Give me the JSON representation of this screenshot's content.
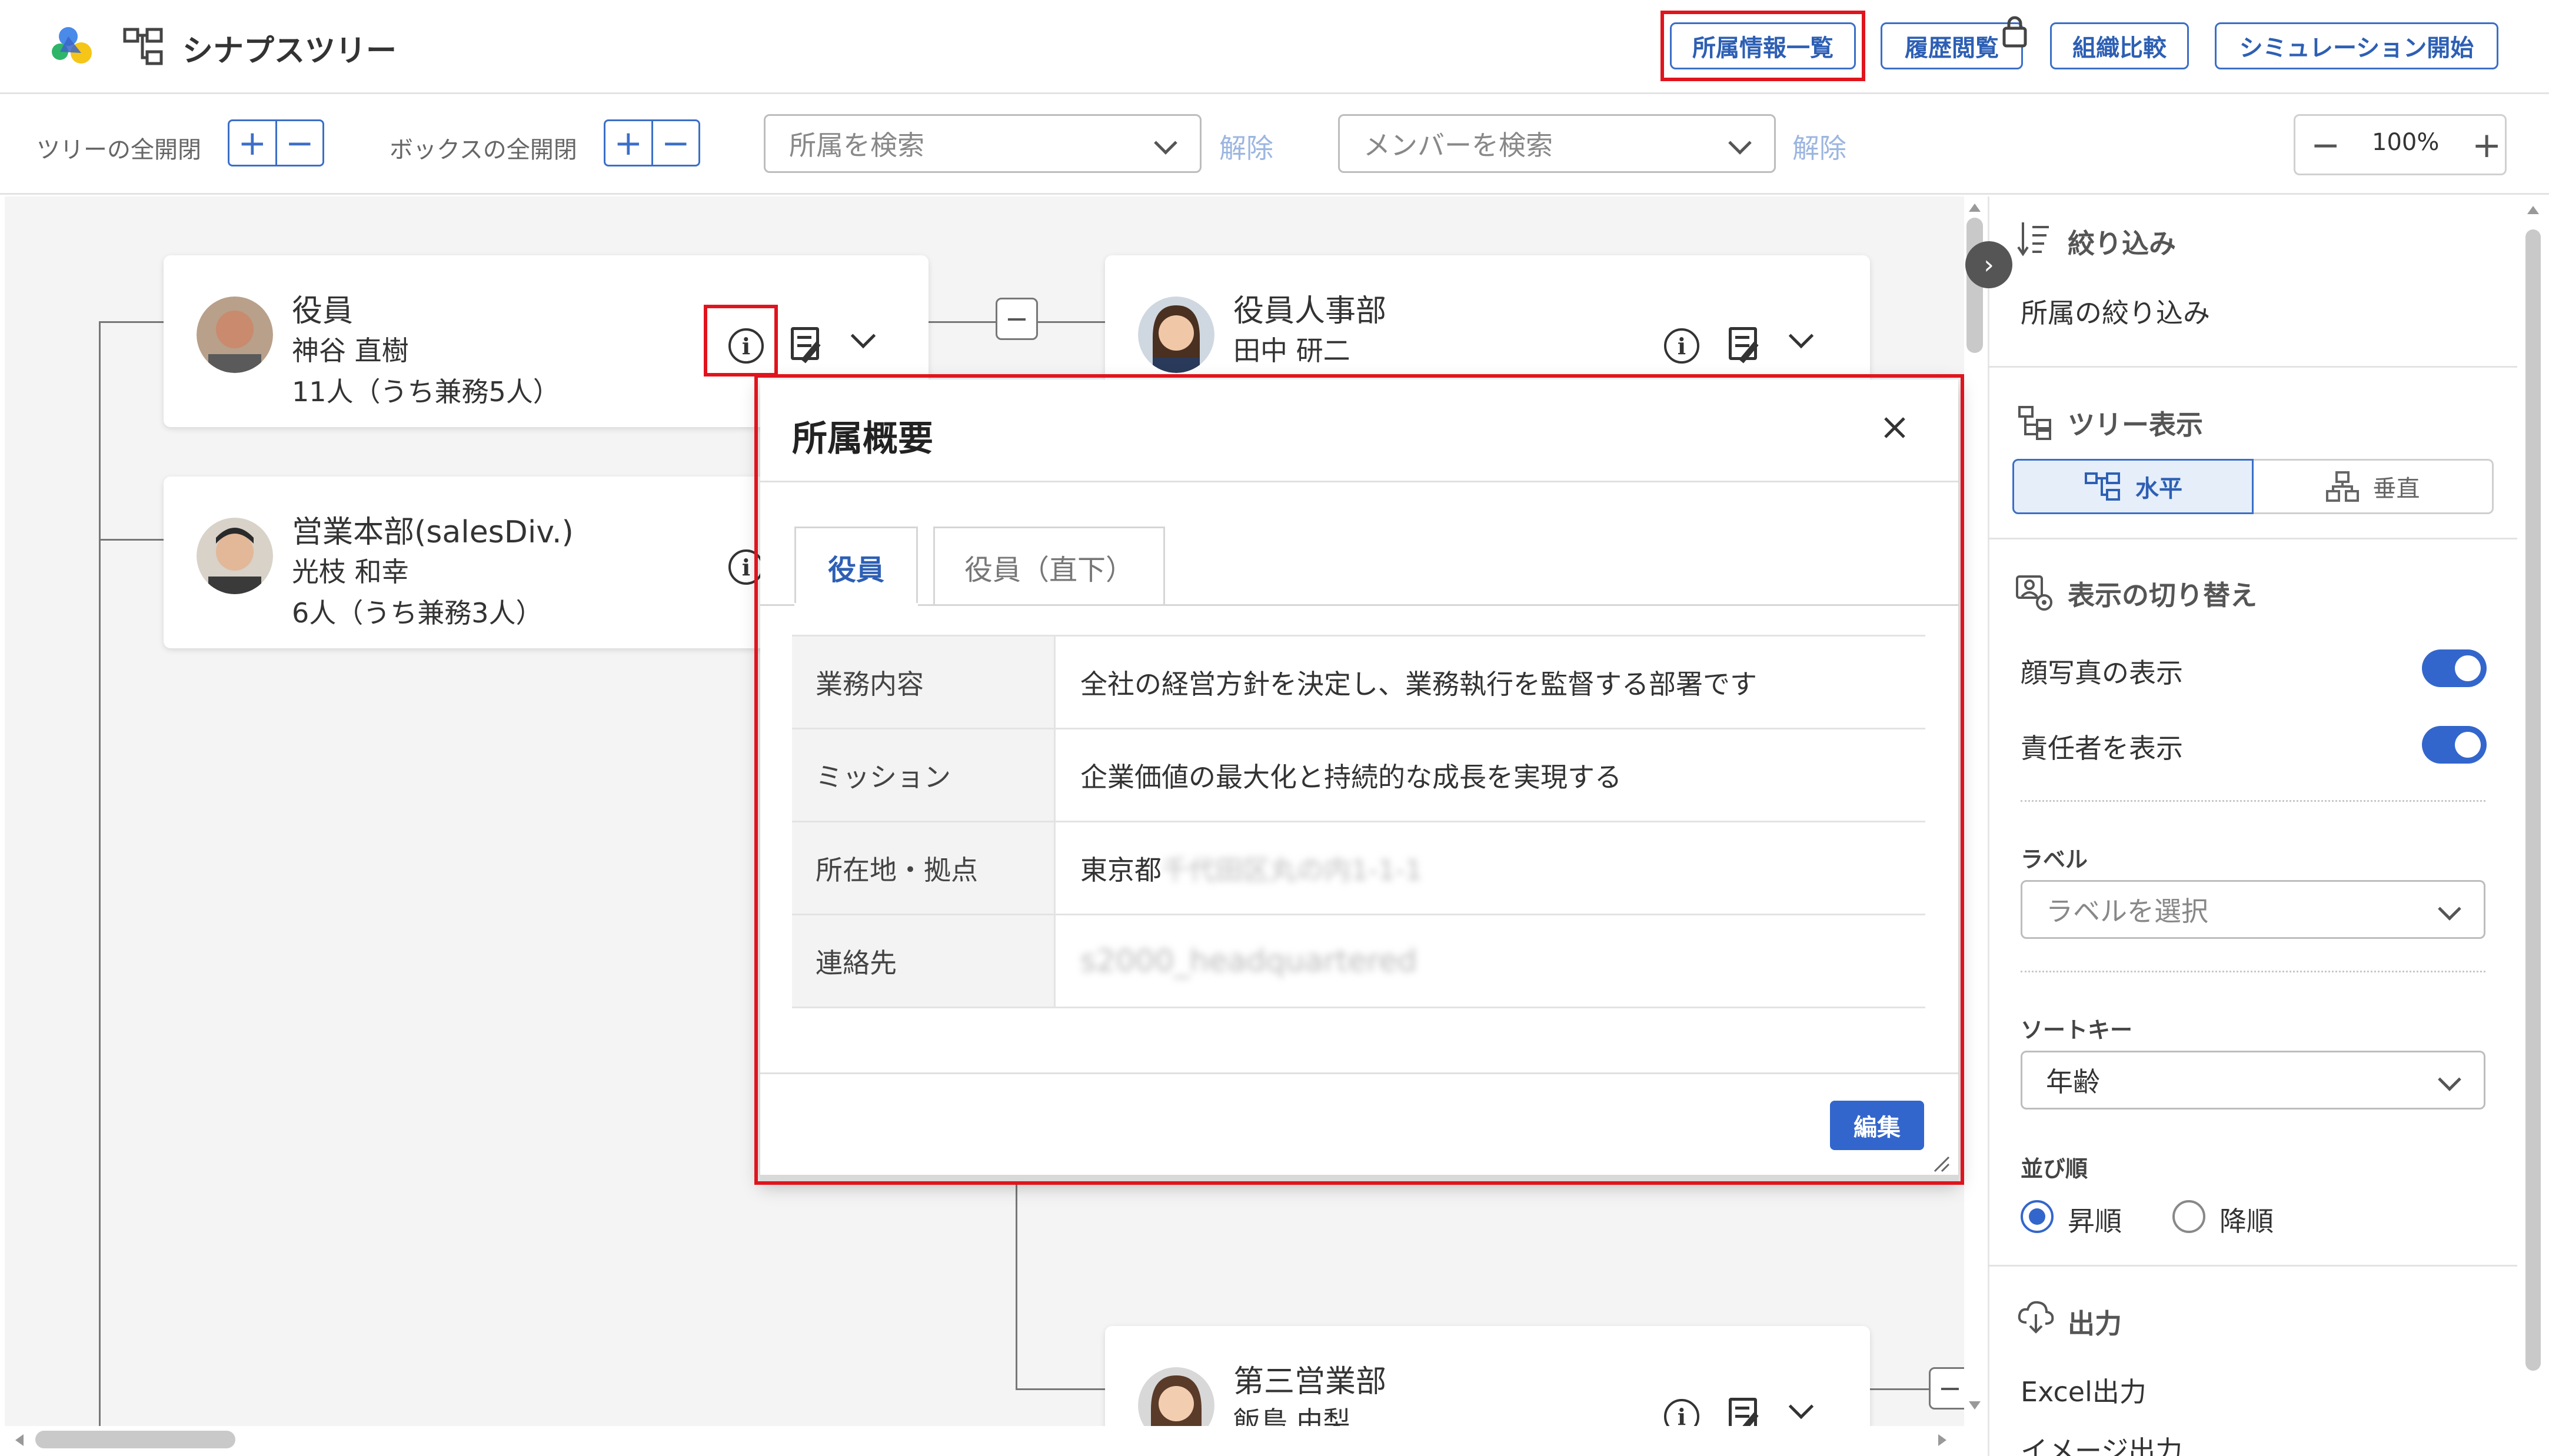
{
  "app": {
    "title": "シナプスツリー"
  },
  "header": {
    "buttons": {
      "affiliation_list": "所属情報一覧",
      "history": "履歴閲覧",
      "compare": "組織比較",
      "simulation": "シミュレーション開始"
    }
  },
  "toolbar": {
    "tree_expand_label": "ツリーの全開閉",
    "box_expand_label": "ボックスの全開閉",
    "dept_search_placeholder": "所属を検索",
    "member_search_placeholder": "メンバーを検索",
    "clear_label": "解除",
    "zoom": "100%"
  },
  "tree": {
    "cards": [
      {
        "dept": "役員",
        "leader": "神谷 直樹",
        "count": "11人（うち兼務5人）"
      },
      {
        "dept": "営業本部(salesDiv.)",
        "leader": "光枝 和幸",
        "count": "6人（うち兼務3人）"
      },
      {
        "dept": "役員人事部",
        "leader": "田中 研二",
        "count": ""
      },
      {
        "dept": "第三営業部",
        "leader": "飯島 由梨",
        "count": ""
      }
    ]
  },
  "modal": {
    "title": "所属概要",
    "tabs": [
      "役員",
      "役員（直下）"
    ],
    "rows": [
      {
        "label": "業務内容",
        "value": "全社の経営方針を決定し、業務執行を監督する部署です",
        "blurred": ""
      },
      {
        "label": "ミッション",
        "value": "企業価値の最大化と持続的な成長を実現する",
        "blurred": ""
      },
      {
        "label": "所在地・拠点",
        "value": "東京都",
        "blurred": "千代田区丸の内1-1-1"
      },
      {
        "label": "連絡先",
        "value": "",
        "blurred": "s2000_headquartered"
      }
    ],
    "edit_label": "編集"
  },
  "panel": {
    "filter_title": "絞り込み",
    "filter_item": "所属の絞り込み",
    "tree_view_title": "ツリー表示",
    "horizontal_label": "水平",
    "vertical_label": "垂直",
    "display_title": "表示の切り替え",
    "show_photo_label": "顔写真の表示",
    "show_leader_label": "責任者を表示",
    "label_title": "ラベル",
    "label_placeholder": "ラベルを選択",
    "sort_key_title": "ソートキー",
    "sort_key_value": "年齢",
    "order_title": "並び順",
    "asc_label": "昇順",
    "desc_label": "降順",
    "output_title": "出力",
    "excel_label": "Excel出力",
    "image_label": "イメージ出力"
  },
  "colors": {
    "accent": "#3366cc",
    "highlight": "#e0141e"
  }
}
